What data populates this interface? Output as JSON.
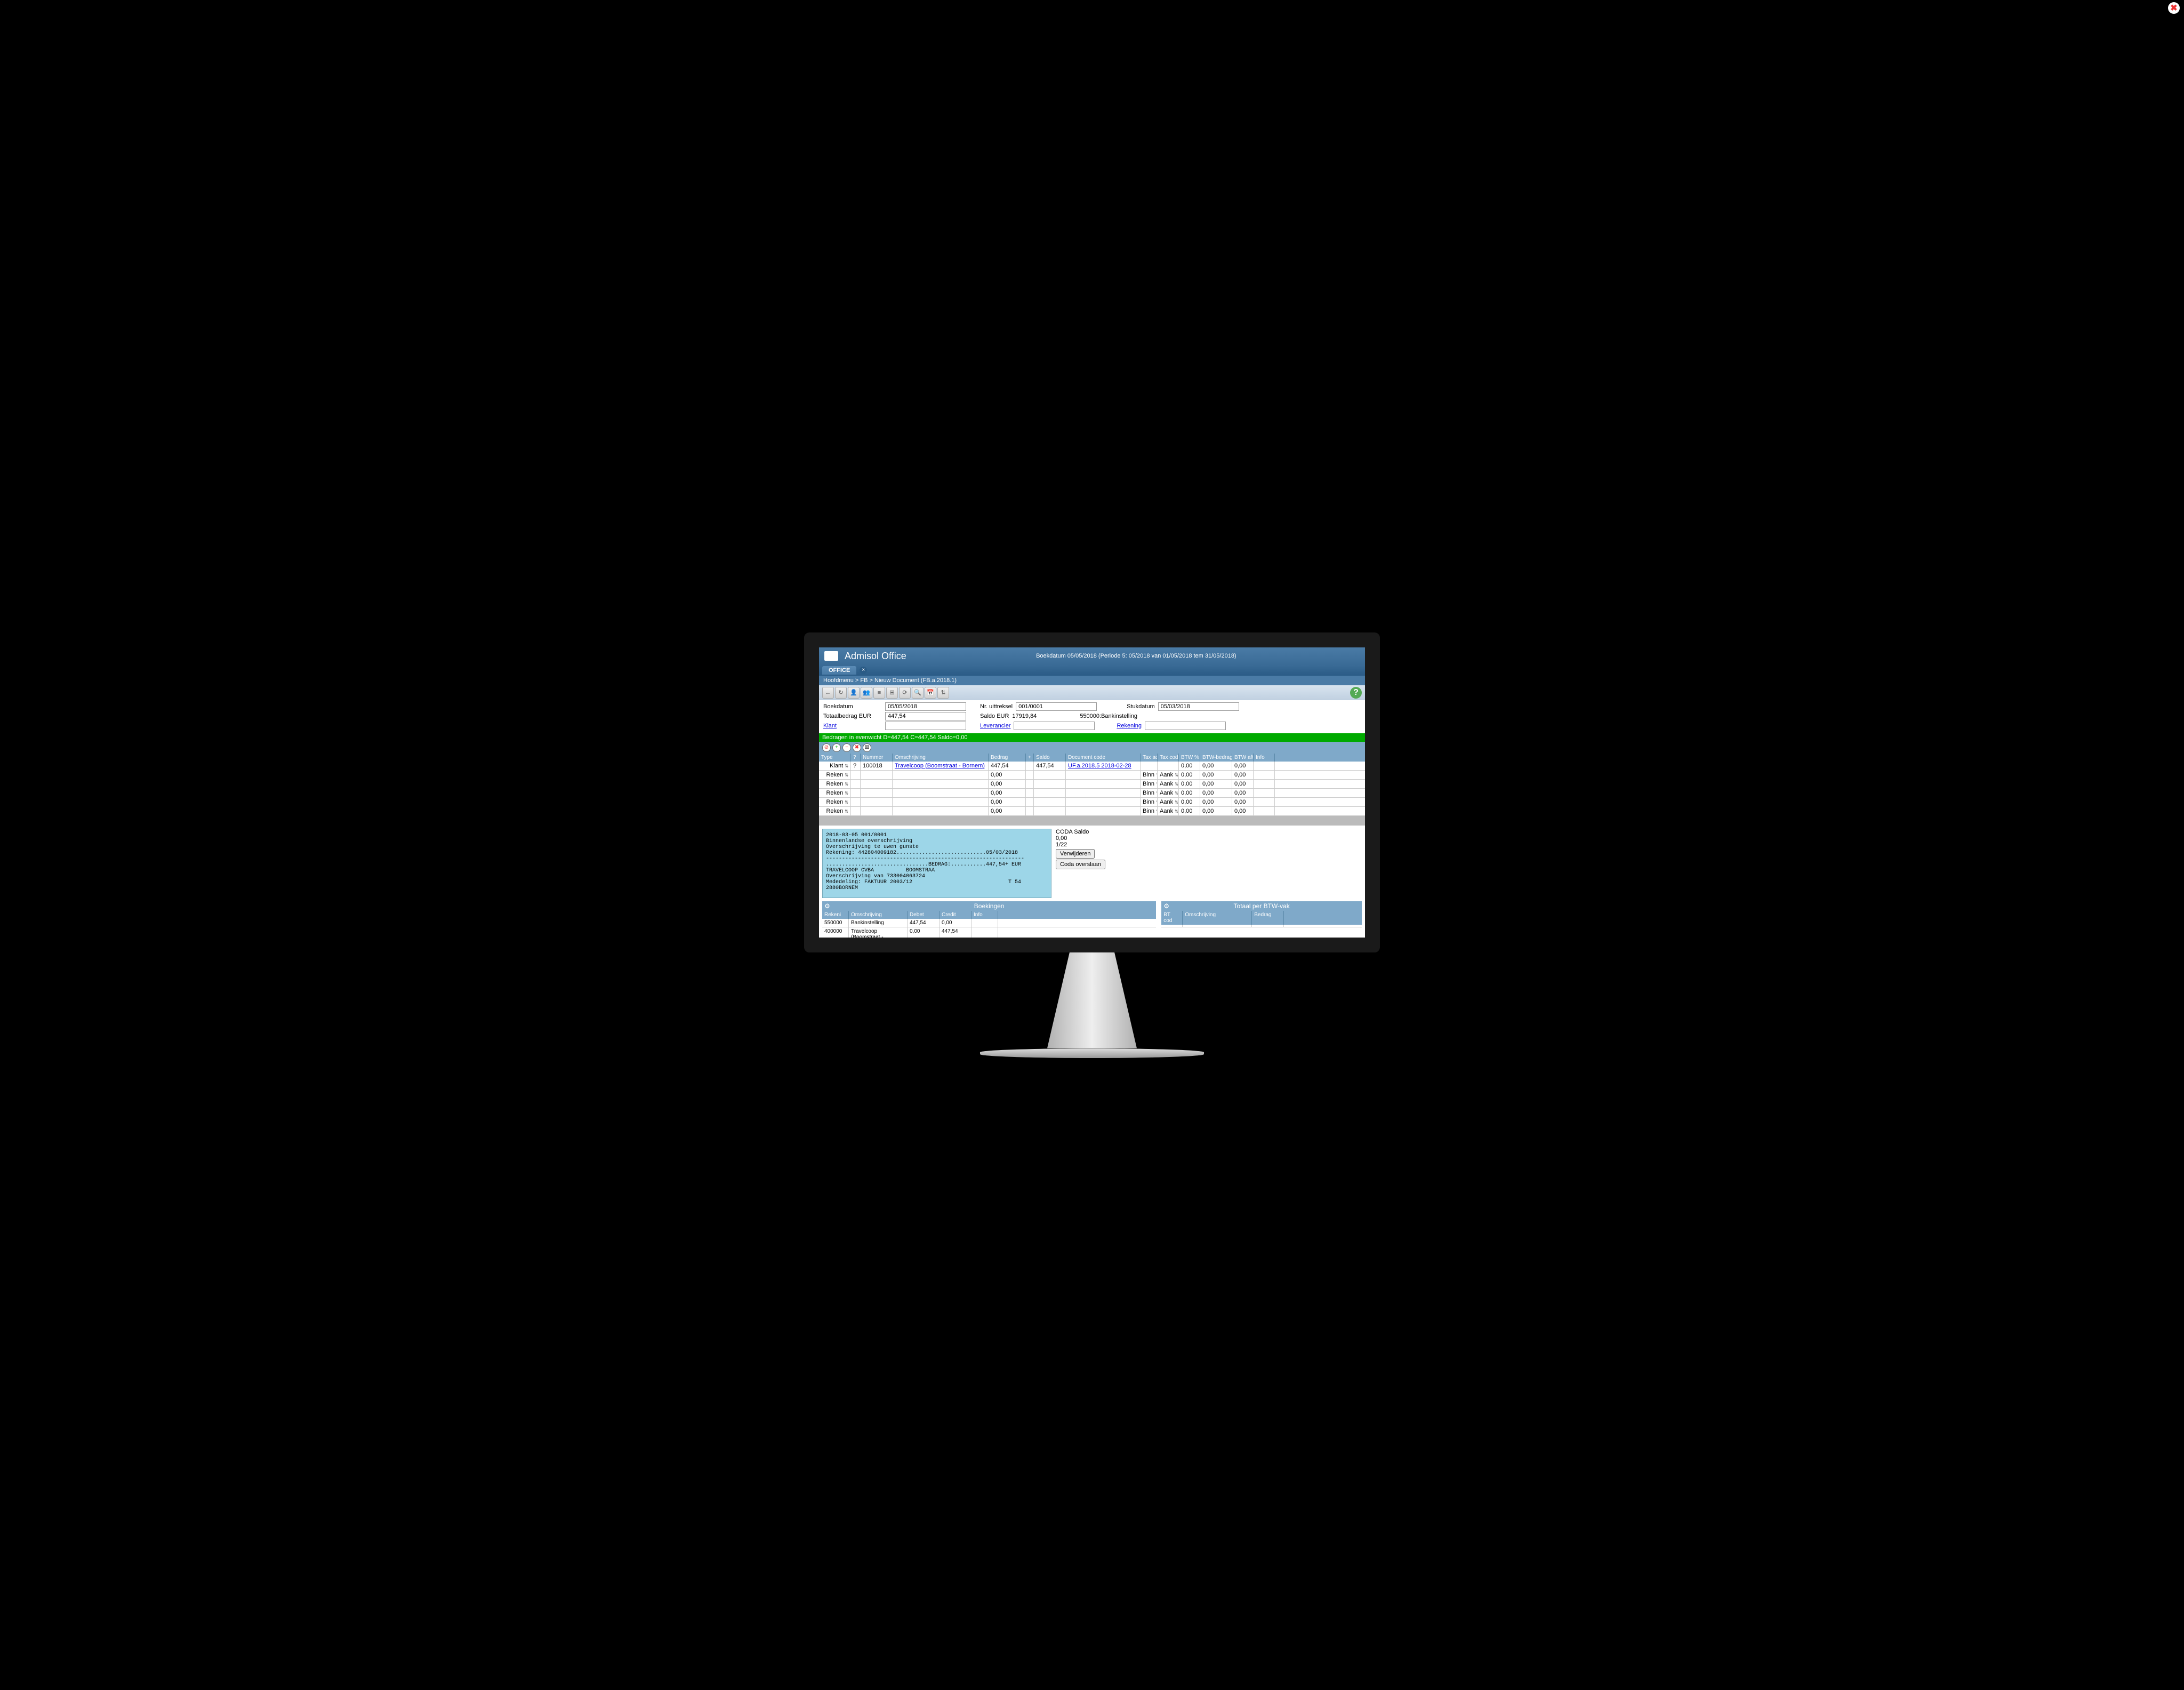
{
  "app_title": "Admisol Office",
  "subtitle": "Boekdatum 05/05/2018 (Periode 5: 05/2018 van 01/05/2018 tem 31/05/2018)",
  "tab": "OFFICE",
  "breadcrumb": "Hoofdmenu  >  FB  >  Nieuw Document (FB.a.2018.1)",
  "form": {
    "boekdatum_lbl": "Boekdatum",
    "boekdatum": "05/05/2018",
    "nr_lbl": "Nr. uittreksel",
    "nr": "001/0001",
    "stukdatum_lbl": "Stukdatum",
    "stukdatum": "05/03/2018",
    "totaal_lbl": "Totaalbedrag EUR",
    "totaal": "447,54",
    "saldo_lbl": "Saldo EUR",
    "saldo": "17919,84",
    "bank_lbl": "550000:Bankinstelling",
    "klant": "Klant",
    "lever": "Leverancier",
    "reken": "Rekening"
  },
  "balance": "Bedragen in evenwicht D=447,54 C=447,54 Saldo=0,00",
  "cols": {
    "type": "Type",
    "q": "?",
    "num": "Nummer",
    "desc": "Omschrijving",
    "amt": "Bedrag",
    "saldo": "Saldo",
    "doc": "Document code",
    "adr": "Tax adr",
    "cod": "Tax cod",
    "btw": "BTW %",
    "btwb": "BTW-bedrag",
    "aftr": "BTW aftrek",
    "info": "Info"
  },
  "rows": [
    {
      "type": "Klant",
      "q": "?",
      "num": "100018",
      "desc": "Travelcoop (Boomstraat - Bornem)",
      "amt": "447,54",
      "saldo": "447,54",
      "doc": "UF.a.2018.5 2018-02-28",
      "adr": "",
      "cod": "",
      "btw": "0,00",
      "btwb": "0,00",
      "aftr": "0,00",
      "link": true
    },
    {
      "type": "Reken",
      "q": "",
      "num": "",
      "desc": "",
      "amt": "0,00",
      "saldo": "",
      "doc": "",
      "adr": "Binn",
      "cod": "Aank",
      "btw": "0,00",
      "btwb": "0,00",
      "aftr": "0,00"
    },
    {
      "type": "Reken",
      "q": "",
      "num": "",
      "desc": "",
      "amt": "0,00",
      "saldo": "",
      "doc": "",
      "adr": "Binn",
      "cod": "Aank",
      "btw": "0,00",
      "btwb": "0,00",
      "aftr": "0,00"
    },
    {
      "type": "Reken",
      "q": "",
      "num": "",
      "desc": "",
      "amt": "0,00",
      "saldo": "",
      "doc": "",
      "adr": "Binn",
      "cod": "Aank",
      "btw": "0,00",
      "btwb": "0,00",
      "aftr": "0,00"
    },
    {
      "type": "Reken",
      "q": "",
      "num": "",
      "desc": "",
      "amt": "0,00",
      "saldo": "",
      "doc": "",
      "adr": "Binn",
      "cod": "Aank",
      "btw": "0,00",
      "btwb": "0,00",
      "aftr": "0,00"
    },
    {
      "type": "Reken",
      "q": "",
      "num": "",
      "desc": "",
      "amt": "0,00",
      "saldo": "",
      "doc": "",
      "adr": "Binn",
      "cod": "Aank",
      "btw": "0,00",
      "btwb": "0,00",
      "aftr": "0,00"
    }
  ],
  "memo": "2018-03-05 001/0001\nBinnenlandse overschrijving\nOverschrijving te uwen gunste\nRekening: 442804009182............................05/03/2018\n--------------------------------------------------------------\n................................BEDRAG:...........447,54+ EUR\nTRAVELCOOP CVBA          BOOMSTRAA\nOverschrijving van 733004063724\nMededeling: FAKTUUR 2003/12                              T 54\n2880BORNEM",
  "coda": {
    "label": "CODA Saldo",
    "val": "0,00",
    "pos": "1/22",
    "btn1": "Verwijderen",
    "btn2": "Coda overslaan"
  },
  "boekingen": {
    "title": "Boekingen",
    "cols": {
      "rek": "Rekeni",
      "oms": "Omschrijving",
      "deb": "Debet",
      "cre": "Credit",
      "inf": "Info"
    },
    "rows": [
      {
        "rek": "550000",
        "oms": "Bankinstelling",
        "deb": "447,54",
        "cre": "0,00",
        "inf": ""
      },
      {
        "rek": "400000",
        "oms": "Travelcoop (Boomstraat -",
        "deb": "0,00",
        "cre": "447,54",
        "inf": ""
      }
    ]
  },
  "btwvak": {
    "title": "Totaal per BTW-vak",
    "cols": {
      "btw": "BT cod",
      "oms": "Omschrijving",
      "bed": "Bedrag"
    }
  }
}
